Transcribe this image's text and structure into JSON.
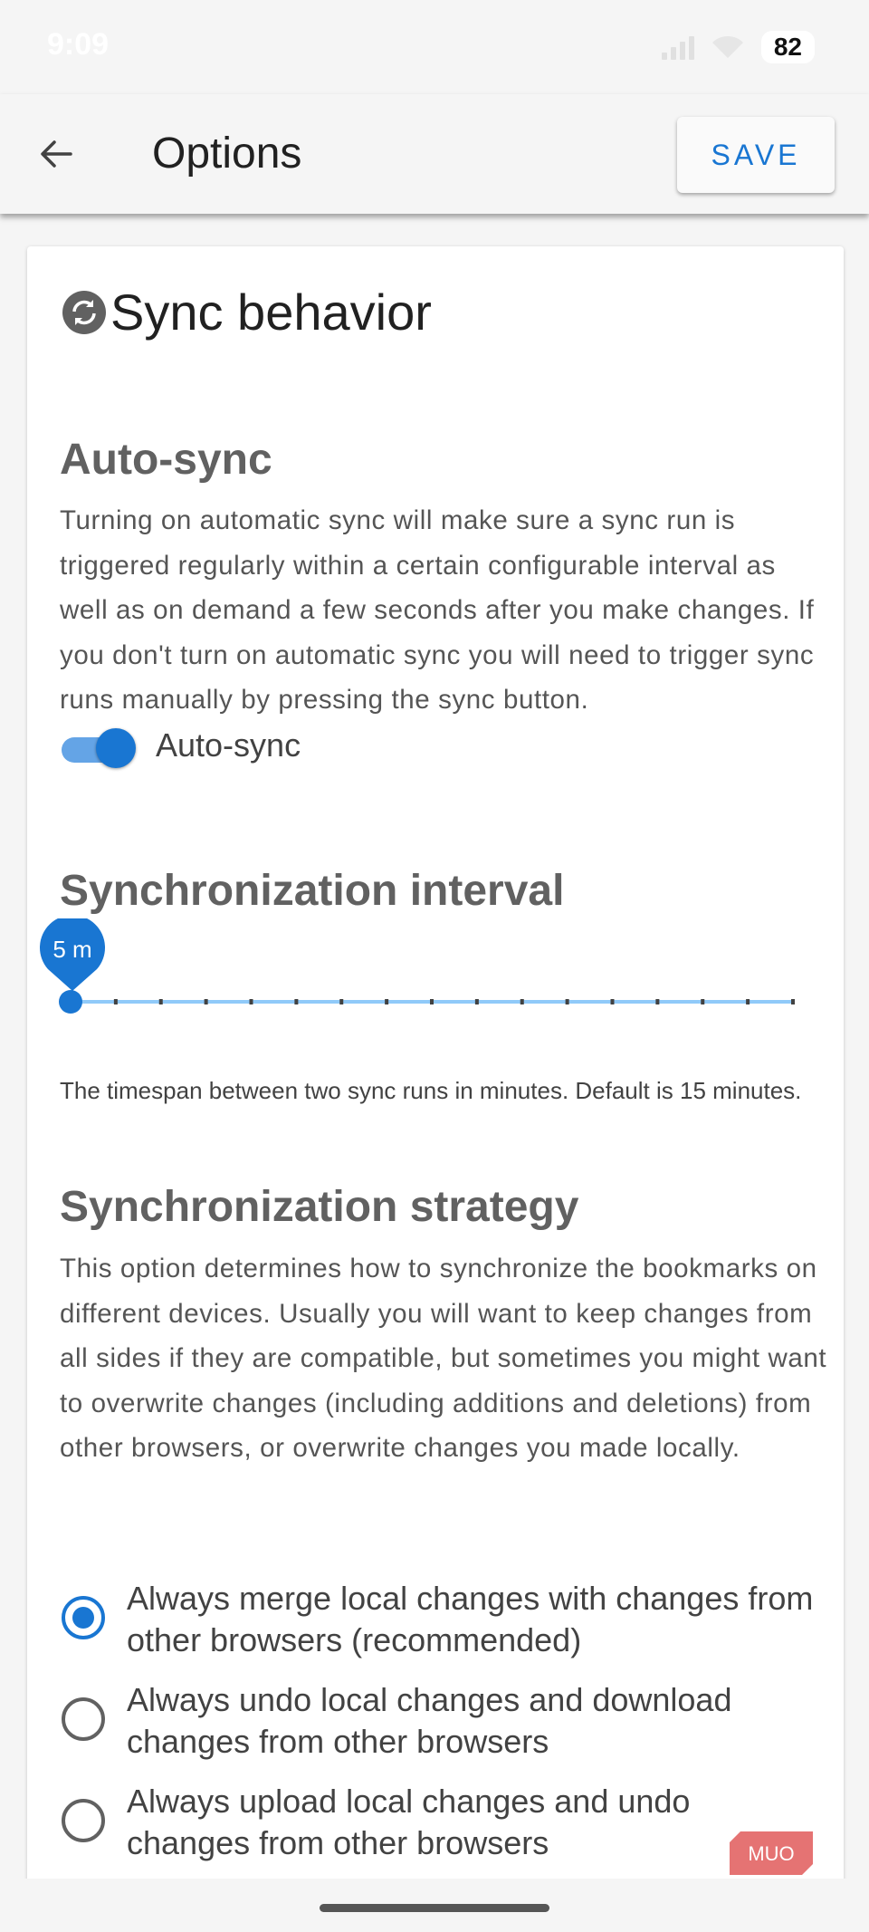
{
  "status_bar": {
    "time": "9:09",
    "battery": "82",
    "icons": [
      "signal-icon",
      "wifi-icon",
      "battery-icon"
    ]
  },
  "app_bar": {
    "title": "Options",
    "save_label": "SAVE",
    "back_icon": "arrow-left-icon"
  },
  "sync_section": {
    "title": "Sync behavior",
    "icon": "sync-icon"
  },
  "auto_sync": {
    "heading": "Auto-sync",
    "description": "Turning on automatic sync will make sure a sync run is triggered regularly within a certain configurable interval as well as on demand a few seconds after you make changes. If you don't turn on automatic sync you will need to trigger sync runs manually by pressing the sync button.",
    "toggle_label": "Auto-sync",
    "toggle_on": true
  },
  "interval": {
    "heading": "Synchronization interval",
    "value_label": "5 m",
    "value": 5,
    "min": 5,
    "max": 120,
    "steps": 16,
    "note": "The timespan between two sync runs in minutes. Default is 15 minutes."
  },
  "strategy": {
    "heading": "Synchronization strategy",
    "description": "This option determines how to synchronize the bookmarks on different devices. Usually you will want to keep changes from all sides if they are compatible, but sometimes you might want to overwrite changes (including additions and deletions) from other browsers, or overwrite changes you made locally.",
    "options": [
      {
        "label": "Always merge local changes with changes from other browsers (recommended)",
        "selected": true
      },
      {
        "label": "Always undo local changes and download changes from other browsers",
        "selected": false
      },
      {
        "label": "Always upload local changes and undo changes from other browsers",
        "selected": false
      }
    ]
  },
  "watermark": {
    "text": "MUO"
  },
  "colors": {
    "accent": "#1976d2",
    "accent_light": "#64a4e6",
    "heading": "#616161",
    "watermark": "#e57373"
  }
}
